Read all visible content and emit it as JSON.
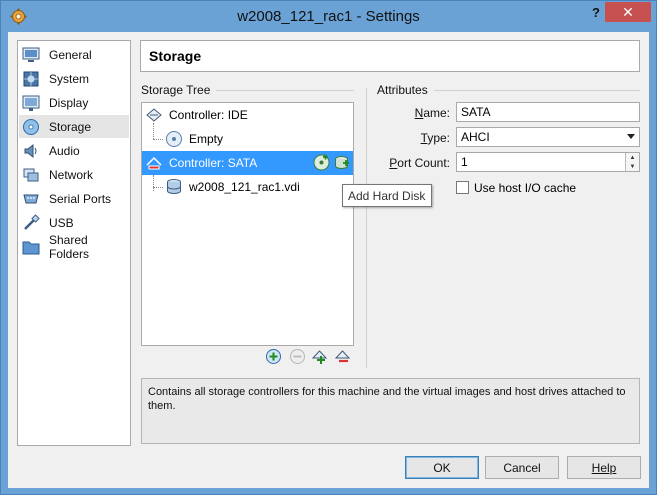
{
  "window": {
    "title": "w2008_121_rac1 - Settings",
    "help_glyph": "?",
    "close_glyph": "✕"
  },
  "sidebar": {
    "items": [
      {
        "label": "General",
        "icon": "general-icon"
      },
      {
        "label": "System",
        "icon": "system-icon"
      },
      {
        "label": "Display",
        "icon": "display-icon"
      },
      {
        "label": "Storage",
        "icon": "storage-icon",
        "active": true
      },
      {
        "label": "Audio",
        "icon": "audio-icon"
      },
      {
        "label": "Network",
        "icon": "network-icon"
      },
      {
        "label": "Serial Ports",
        "icon": "serial-ports-icon"
      },
      {
        "label": "USB",
        "icon": "usb-icon"
      },
      {
        "label": "Shared Folders",
        "icon": "shared-folders-icon"
      }
    ]
  },
  "page": {
    "title": "Storage"
  },
  "storage_tree": {
    "label": "Storage Tree",
    "rows": [
      {
        "label": "Controller: IDE",
        "type": "controller"
      },
      {
        "label": "Empty",
        "type": "optical"
      },
      {
        "label": "Controller: SATA",
        "type": "controller",
        "selected": true
      },
      {
        "label": "w2008_121_rac1.vdi",
        "type": "hard-disk"
      }
    ],
    "tooltip": "Add Hard Disk"
  },
  "attributes": {
    "label": "Attributes",
    "name_label": "Name:",
    "name_label_mnemonic": "N",
    "name_label_rest": "ame:",
    "name_value": "SATA",
    "type_label_mnemonic": "T",
    "type_label_rest": "ype:",
    "type_value": "AHCI",
    "port_count_label_mnemonic": "P",
    "port_count_label_rest": "ort Count:",
    "port_count_value": "1",
    "host_io_cache_label": "Use host I/O cache",
    "host_io_cache_checked": false
  },
  "description": "Contains all storage controllers for this machine and the virtual images and host drives attached to them.",
  "buttons": {
    "ok": "OK",
    "cancel": "Cancel",
    "help": "Help"
  },
  "colors": {
    "title_bar": "#6aa2d6",
    "selection": "#3399ff",
    "close_button": "#c75050"
  }
}
